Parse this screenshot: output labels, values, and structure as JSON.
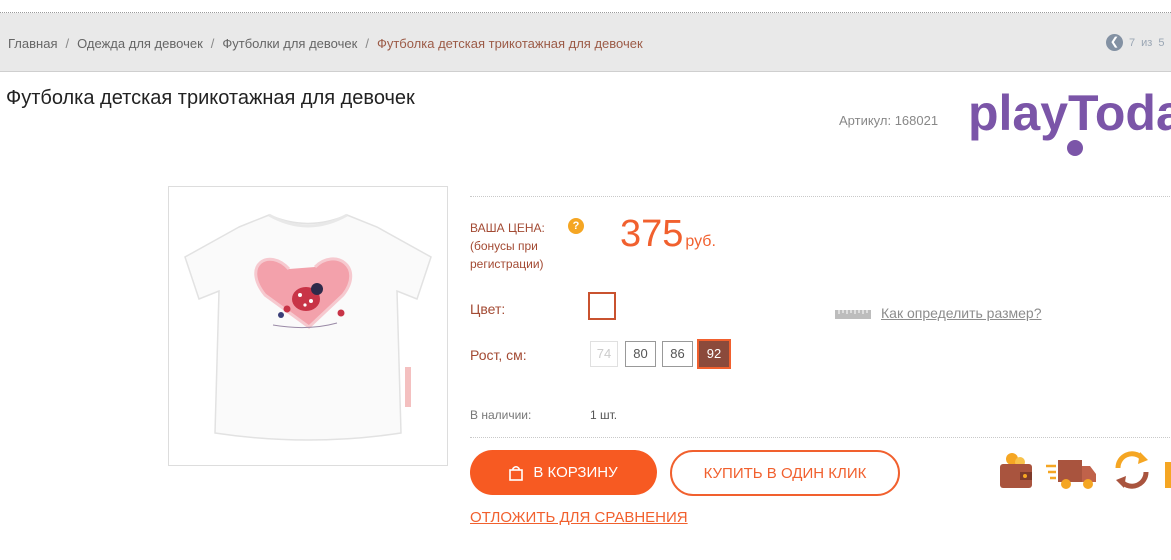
{
  "breadcrumb": {
    "items": [
      "Главная",
      "Одежда для девочек",
      "Футболки для девочек"
    ],
    "current": "Футболка детская трикотажная для девочек",
    "separator": "/"
  },
  "pager": {
    "current": "7",
    "of_label": "из",
    "total_partial": "5"
  },
  "product": {
    "title": "Футболка детская трикотажная для девочек",
    "article": "Артикул: 168021"
  },
  "brand": {
    "logo_text": "playToday",
    "color": "#7b55a8"
  },
  "price": {
    "label_line1": "ВАША ЦЕНА:",
    "label_line2": "(бонусы при",
    "label_line3": "регистрации)",
    "help_icon": "?",
    "value": "375",
    "currency": "руб."
  },
  "color": {
    "label": "Цвет:"
  },
  "size_help": {
    "label": "Как определить размер?"
  },
  "height": {
    "label": "Рост, см:",
    "options": [
      "74",
      "80",
      "86",
      "92"
    ],
    "selected": "92",
    "disabled": [
      "74"
    ]
  },
  "stock": {
    "label": "В наличии:",
    "value": "1 шт."
  },
  "buttons": {
    "cart": "В КОРЗИНУ",
    "one_click": "КУПИТЬ В ОДИН КЛИК",
    "compare": "ОТЛОЖИТЬ ДЛЯ СРАВНЕНИЯ"
  },
  "features": [
    "wallet-icon",
    "delivery-truck-icon",
    "exchange-icon"
  ],
  "colors": {
    "accent": "#f75a22",
    "label": "#a34a33",
    "brand_purple": "#7b55a8"
  }
}
